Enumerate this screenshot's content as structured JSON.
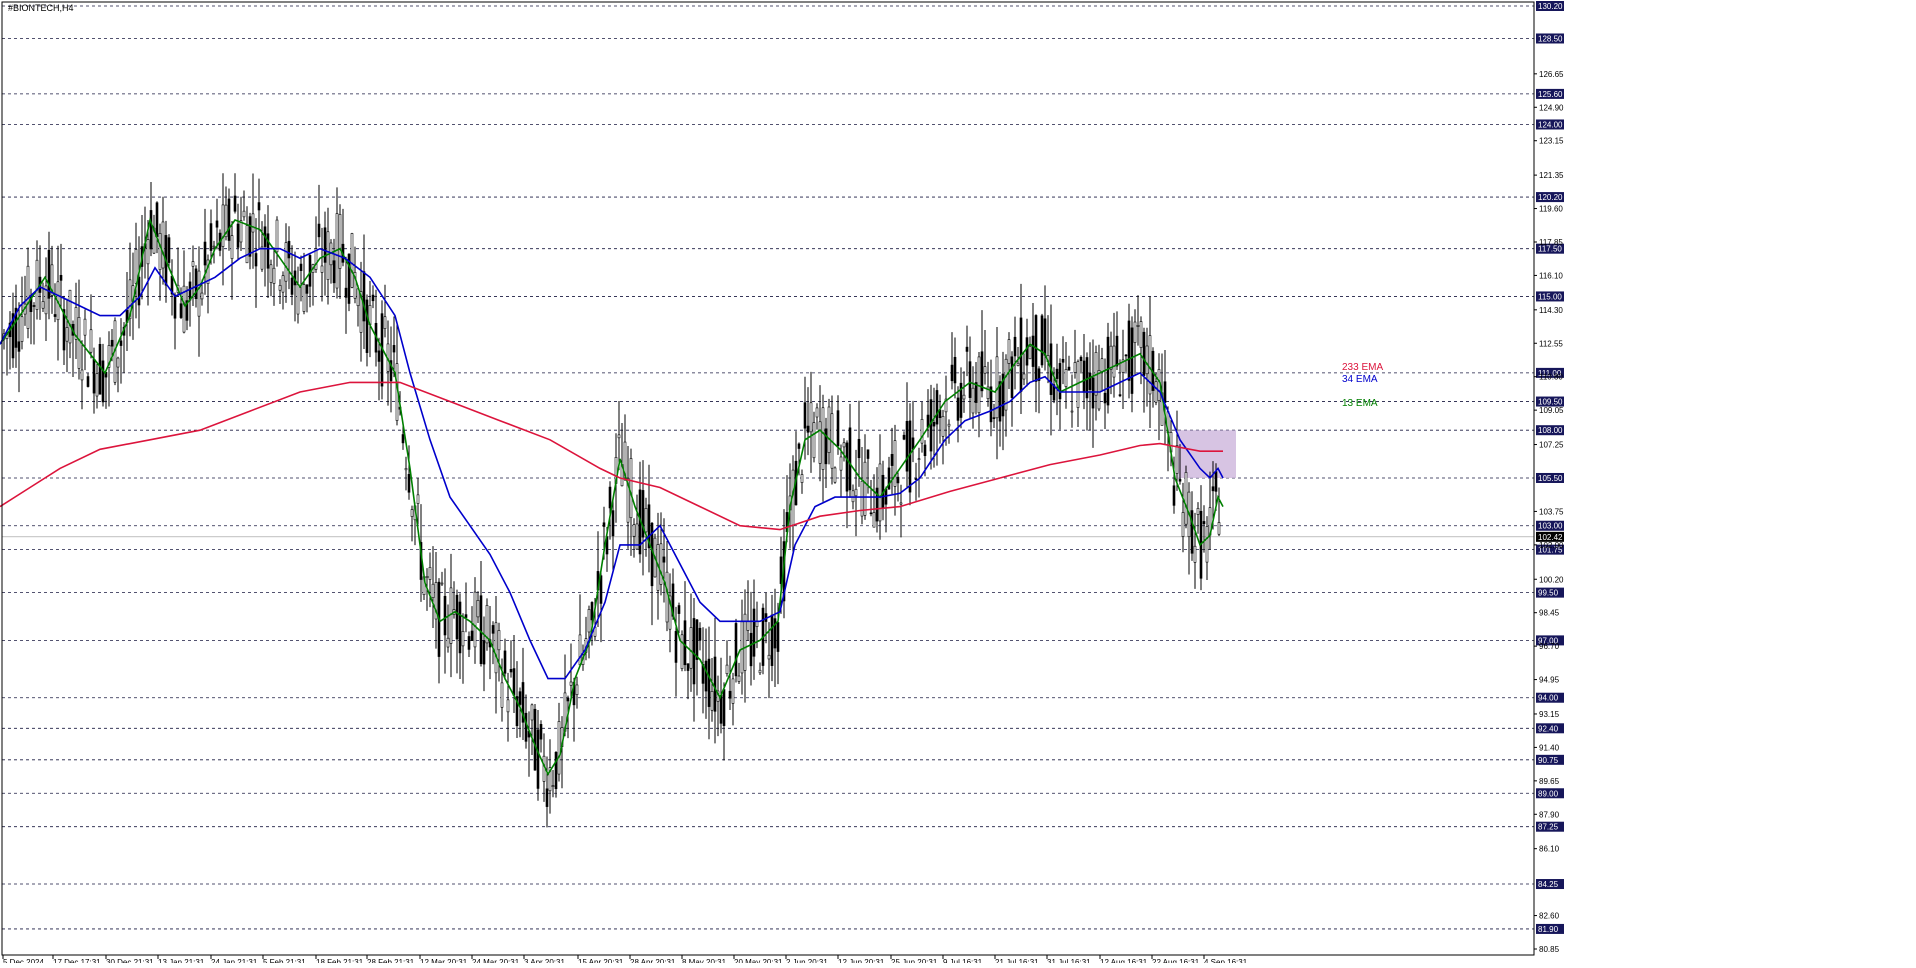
{
  "chart_data": {
    "type": "candlestick",
    "title": "#BIONTECH,H4",
    "x_tick_labels": [
      "5 Dec 2024",
      "17 Dec 17:31",
      "30 Dec 21:31",
      "13 Jan 21:31",
      "24 Jan 21:31",
      "5 Feb 21:31",
      "18 Feb 21:31",
      "28 Feb 21:31",
      "12 Mar 20:31",
      "24 Mar 20:31",
      "3 Apr 20:31",
      "15 Apr 20:31",
      "28 Apr 20:31",
      "8 May 20:31",
      "20 May 20:31",
      "2 Jun 20:31",
      "12 Jun 20:31",
      "25 Jun 20:31",
      "9 Jul 16:31",
      "21 Jul 16:31",
      "31 Jul 16:31",
      "12 Aug 16:31",
      "22 Aug 16:31",
      "4 Sep 16:31"
    ],
    "y_tick_labels": [
      "126.65",
      "124.90",
      "123.15",
      "121.35",
      "119.60",
      "117.85",
      "116.10",
      "114.30",
      "112.55",
      "110.80",
      "109.05",
      "107.25",
      "103.75",
      "102.00",
      "100.20",
      "98.45",
      "96.70",
      "94.95",
      "93.15",
      "91.40",
      "89.65",
      "87.90",
      "86.10",
      "82.60",
      "80.85"
    ],
    "ylim": [
      80.85,
      130.2
    ],
    "levels": [
      130.2,
      128.5,
      125.6,
      124.0,
      120.2,
      117.5,
      115.0,
      111.0,
      109.5,
      108.0,
      105.5,
      103.0,
      101.75,
      99.5,
      97.0,
      94.0,
      92.4,
      90.75,
      89.0,
      87.25,
      84.25,
      81.9
    ],
    "level_labels": [
      "130.20",
      "128.50",
      "125.60",
      "124.00",
      "120.20",
      "117.50",
      "115.00",
      "111.00",
      "109.50",
      "108.00",
      "105.50",
      "103.00",
      "101.75",
      "99.50",
      "97.00",
      "94.00",
      "92.40",
      "90.75",
      "89.00",
      "87.25",
      "84.25",
      "81.90"
    ],
    "current_price": 102.42,
    "current_price_label": "102.42",
    "series": [
      {
        "name": "13 EMA",
        "color": "#008000",
        "values": [
          [
            0,
            112.5
          ],
          [
            20,
            114.0
          ],
          [
            45,
            116.0
          ],
          [
            75,
            113.0
          ],
          [
            105,
            111.0
          ],
          [
            130,
            114.0
          ],
          [
            150,
            119.0
          ],
          [
            165,
            117.0
          ],
          [
            185,
            114.5
          ],
          [
            200,
            115.5
          ],
          [
            215,
            117.5
          ],
          [
            235,
            119.0
          ],
          [
            260,
            118.5
          ],
          [
            280,
            117.0
          ],
          [
            300,
            115.5
          ],
          [
            320,
            117.0
          ],
          [
            340,
            117.5
          ],
          [
            355,
            116.0
          ],
          [
            370,
            113.5
          ],
          [
            395,
            111.0
          ],
          [
            410,
            106.0
          ],
          [
            425,
            100.0
          ],
          [
            440,
            98.0
          ],
          [
            455,
            98.5
          ],
          [
            470,
            98.0
          ],
          [
            490,
            97.0
          ],
          [
            505,
            95.0
          ],
          [
            520,
            93.5
          ],
          [
            535,
            91.5
          ],
          [
            548,
            90.0
          ],
          [
            560,
            91.0
          ],
          [
            575,
            95.0
          ],
          [
            590,
            97.0
          ],
          [
            605,
            102.0
          ],
          [
            620,
            106.5
          ],
          [
            635,
            104.0
          ],
          [
            650,
            102.0
          ],
          [
            665,
            100.0
          ],
          [
            680,
            97.0
          ],
          [
            700,
            96.0
          ],
          [
            720,
            94.0
          ],
          [
            740,
            96.5
          ],
          [
            760,
            97.0
          ],
          [
            778,
            98.0
          ],
          [
            790,
            104.0
          ],
          [
            805,
            107.5
          ],
          [
            820,
            108.0
          ],
          [
            840,
            107.0
          ],
          [
            860,
            105.5
          ],
          [
            880,
            104.5
          ],
          [
            900,
            106.0
          ],
          [
            920,
            107.5
          ],
          [
            945,
            109.5
          ],
          [
            970,
            110.5
          ],
          [
            995,
            110.0
          ],
          [
            1015,
            111.5
          ],
          [
            1030,
            112.5
          ],
          [
            1045,
            112.0
          ],
          [
            1060,
            110.0
          ],
          [
            1080,
            110.5
          ],
          [
            1100,
            111.0
          ],
          [
            1120,
            111.5
          ],
          [
            1140,
            112.0
          ],
          [
            1160,
            110.5
          ],
          [
            1175,
            105.5
          ],
          [
            1190,
            103.5
          ],
          [
            1200,
            102.0
          ],
          [
            1210,
            102.5
          ],
          [
            1218,
            104.5
          ],
          [
            1223,
            104.0
          ]
        ]
      },
      {
        "name": "34 EMA",
        "color": "#0000cc",
        "values": [
          [
            0,
            112.5
          ],
          [
            20,
            114.5
          ],
          [
            40,
            115.5
          ],
          [
            60,
            115.0
          ],
          [
            80,
            114.5
          ],
          [
            100,
            114.0
          ],
          [
            120,
            114.0
          ],
          [
            140,
            115.0
          ],
          [
            155,
            116.5
          ],
          [
            175,
            115.0
          ],
          [
            195,
            115.5
          ],
          [
            215,
            116.0
          ],
          [
            240,
            117.0
          ],
          [
            260,
            117.5
          ],
          [
            280,
            117.5
          ],
          [
            300,
            117.0
          ],
          [
            320,
            117.5
          ],
          [
            345,
            117.0
          ],
          [
            370,
            116.0
          ],
          [
            395,
            114.0
          ],
          [
            410,
            111.0
          ],
          [
            430,
            107.5
          ],
          [
            450,
            104.5
          ],
          [
            470,
            103.0
          ],
          [
            490,
            101.5
          ],
          [
            510,
            99.5
          ],
          [
            530,
            97.0
          ],
          [
            548,
            95.0
          ],
          [
            565,
            95.0
          ],
          [
            585,
            96.5
          ],
          [
            605,
            99.0
          ],
          [
            620,
            102.0
          ],
          [
            640,
            102.0
          ],
          [
            660,
            103.0
          ],
          [
            680,
            101.0
          ],
          [
            700,
            99.0
          ],
          [
            720,
            98.0
          ],
          [
            740,
            98.0
          ],
          [
            760,
            98.0
          ],
          [
            780,
            98.5
          ],
          [
            795,
            102.0
          ],
          [
            815,
            104.0
          ],
          [
            835,
            104.5
          ],
          [
            860,
            104.5
          ],
          [
            880,
            104.5
          ],
          [
            900,
            104.7
          ],
          [
            920,
            105.5
          ],
          [
            945,
            107.5
          ],
          [
            965,
            108.5
          ],
          [
            990,
            109.0
          ],
          [
            1010,
            109.5
          ],
          [
            1030,
            110.5
          ],
          [
            1045,
            110.8
          ],
          [
            1060,
            110.0
          ],
          [
            1080,
            110.0
          ],
          [
            1100,
            110.0
          ],
          [
            1120,
            110.5
          ],
          [
            1140,
            111.0
          ],
          [
            1160,
            110.0
          ],
          [
            1180,
            107.5
          ],
          [
            1200,
            106.0
          ],
          [
            1210,
            105.5
          ],
          [
            1218,
            106.0
          ],
          [
            1223,
            105.5
          ]
        ]
      },
      {
        "name": "233 EMA",
        "color": "#dc143c",
        "values": [
          [
            0,
            104.0
          ],
          [
            30,
            105.0
          ],
          [
            60,
            106.0
          ],
          [
            100,
            107.0
          ],
          [
            150,
            107.5
          ],
          [
            200,
            108.0
          ],
          [
            250,
            109.0
          ],
          [
            300,
            110.0
          ],
          [
            350,
            110.5
          ],
          [
            400,
            110.5
          ],
          [
            450,
            109.5
          ],
          [
            500,
            108.5
          ],
          [
            550,
            107.5
          ],
          [
            600,
            106.0
          ],
          [
            620,
            105.5
          ],
          [
            660,
            105.0
          ],
          [
            700,
            104.0
          ],
          [
            740,
            103.0
          ],
          [
            780,
            102.8
          ],
          [
            820,
            103.5
          ],
          [
            860,
            103.8
          ],
          [
            900,
            104.0
          ],
          [
            950,
            104.8
          ],
          [
            1000,
            105.5
          ],
          [
            1050,
            106.2
          ],
          [
            1100,
            106.7
          ],
          [
            1140,
            107.2
          ],
          [
            1160,
            107.3
          ],
          [
            1180,
            107.1
          ],
          [
            1200,
            106.9
          ],
          [
            1223,
            106.9
          ]
        ]
      }
    ],
    "legend": [
      "233 EMA",
      "34 EMA",
      "13 EMA"
    ],
    "highlight_zone": {
      "x0": 1178,
      "x1": 1236,
      "y0": 105.5,
      "y1": 108.0,
      "color": "#cdb5dc"
    }
  }
}
